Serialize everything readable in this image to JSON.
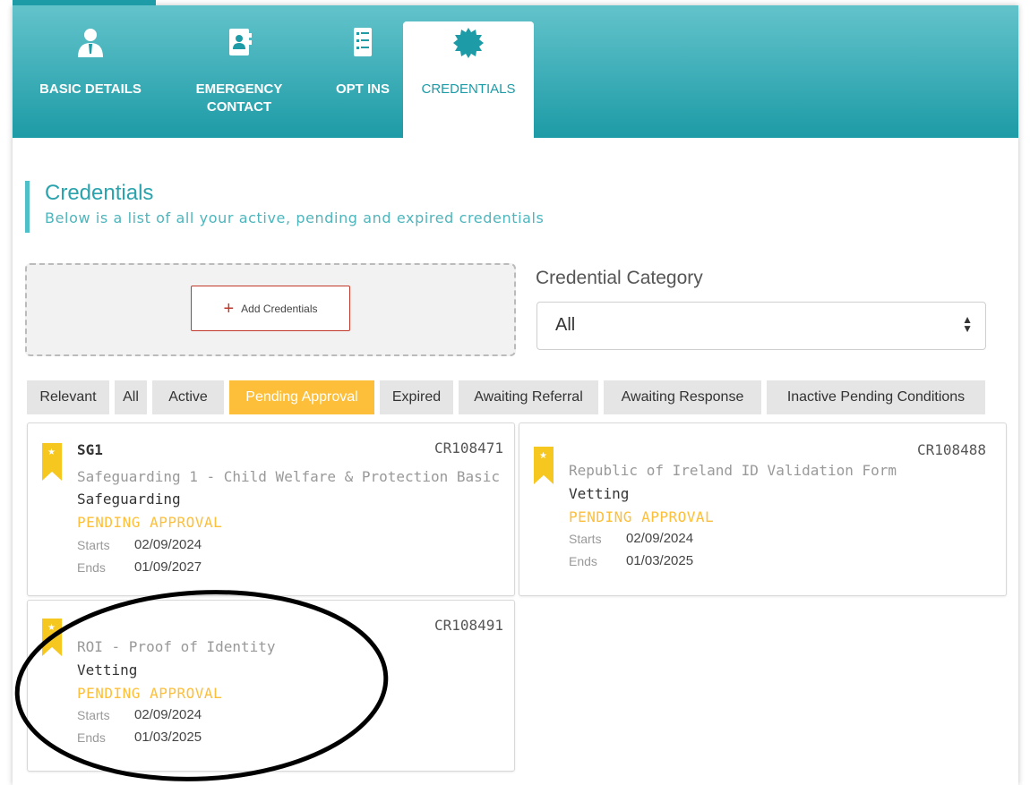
{
  "tabs": [
    {
      "label_line1": "BASIC DETAILS",
      "label_line2": "",
      "icon": "user-icon"
    },
    {
      "label_line1": "EMERGENCY",
      "label_line2": "CONTACT",
      "icon": "contact-book-icon"
    },
    {
      "label_line1": "OPT INS",
      "label_line2": "",
      "icon": "checklist-icon"
    },
    {
      "label_line1": "CREDENTIALS",
      "label_line2": "",
      "icon": "badge-icon"
    }
  ],
  "section": {
    "title": "Credentials",
    "subtitle": "Below is a list of all your active, pending and expired credentials"
  },
  "add_credentials": {
    "label": "Add Credentials",
    "icon": "plus-icon"
  },
  "category": {
    "label": "Credential Category",
    "selected": "All"
  },
  "filters": [
    "Relevant",
    "All",
    "Active",
    "Pending Approval",
    "Expired",
    "Awaiting Referral",
    "Awaiting Response",
    "Inactive Pending Conditions"
  ],
  "active_filter": "Pending Approval",
  "dates_labels": {
    "starts": "Starts",
    "ends": "Ends"
  },
  "cards": [
    {
      "code": "SG1",
      "id": "CR108471",
      "name": "Safeguarding 1 - Child Welfare & Protection Basic ...",
      "category": "Safeguarding",
      "status": "PENDING APPROVAL",
      "starts": "02/09/2024",
      "ends": "01/09/2027"
    },
    {
      "code": "",
      "id": "CR108488",
      "name": "Republic of Ireland ID Validation Form",
      "category": "Vetting",
      "status": "PENDING APPROVAL",
      "starts": "02/09/2024",
      "ends": "01/03/2025"
    },
    {
      "code": "",
      "id": "CR108491",
      "name": "ROI - Proof of Identity",
      "category": "Vetting",
      "status": "PENDING APPROVAL",
      "starts": "02/09/2024",
      "ends": "01/03/2025"
    }
  ],
  "colors": {
    "teal": "#1d9ba6",
    "teal_light": "#63c3cb",
    "pending": "#fdbf3a",
    "ribbon": "#f6c71f",
    "add_border": "#c0392b"
  }
}
